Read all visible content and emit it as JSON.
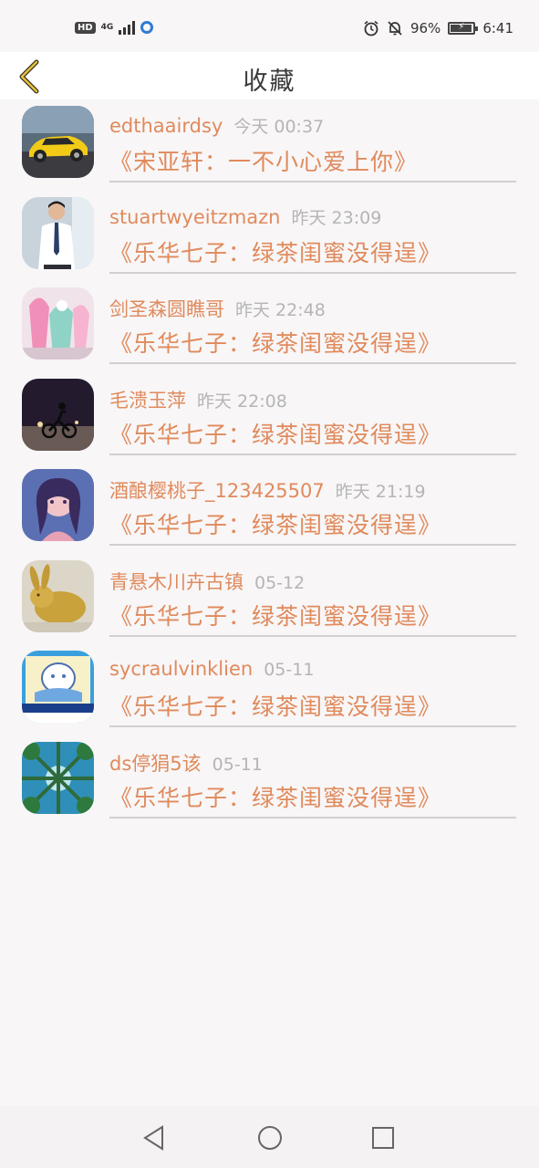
{
  "status_bar": {
    "left": {
      "hd": "HD",
      "network": "4G",
      "signal_icon": "signal-icon",
      "app_icon": "circle-app-icon"
    },
    "right": {
      "alarm_icon": "alarm-icon",
      "mute_icon": "bell-off-icon",
      "battery_percent": "96%",
      "battery_level": 0.96,
      "time": "6:41"
    }
  },
  "header": {
    "title": "收藏",
    "back_icon": "chevron-left-icon"
  },
  "items": [
    {
      "name": "edthaairdsy",
      "time": "今天 00:37",
      "message": "《宋亚轩：一不小心爱上你》",
      "avatar": "yellow-sports-car"
    },
    {
      "name": "stuartwyeitzmazn",
      "time": "昨天 23:09",
      "message": "《乐华七子：绿茶闺蜜没得逞》",
      "avatar": "man-in-suit"
    },
    {
      "name": "剑圣森圆瞧哥",
      "time": "昨天 22:48",
      "message": "《乐华七子：绿茶闺蜜没得逞》",
      "avatar": "pastel-decor"
    },
    {
      "name": "毛溃玉萍",
      "time": "昨天 22:08",
      "message": "《乐华七子：绿茶闺蜜没得逞》",
      "avatar": "motorcycle-night"
    },
    {
      "name": "酒酿樱桃子_123425507",
      "time": "昨天 21:19",
      "message": "《乐华七子：绿茶闺蜜没得逞》",
      "avatar": "anime-girl"
    },
    {
      "name": "青悬木川卉古镇",
      "time": "05-12",
      "message": "《乐华七子：绿茶闺蜜没得逞》",
      "avatar": "jade-rabbit"
    },
    {
      "name": "sycraulvinklien",
      "time": "05-11",
      "message": "《乐华七子：绿茶闺蜜没得逞》",
      "avatar": "sagittarius-cartoon"
    },
    {
      "name": "ds停狷5该",
      "time": "05-11",
      "message": "《乐华七子：绿茶闺蜜没得逞》",
      "avatar": "forest-sky"
    }
  ],
  "nav_bar": {
    "back": "triangle-back-icon",
    "home": "circle-home-icon",
    "recent": "square-recent-icon"
  },
  "colors": {
    "accent": "#e08a5c",
    "time": "#b5b5b5",
    "header_bg": "#ffffff",
    "page_bg": "#f8f6f7"
  }
}
